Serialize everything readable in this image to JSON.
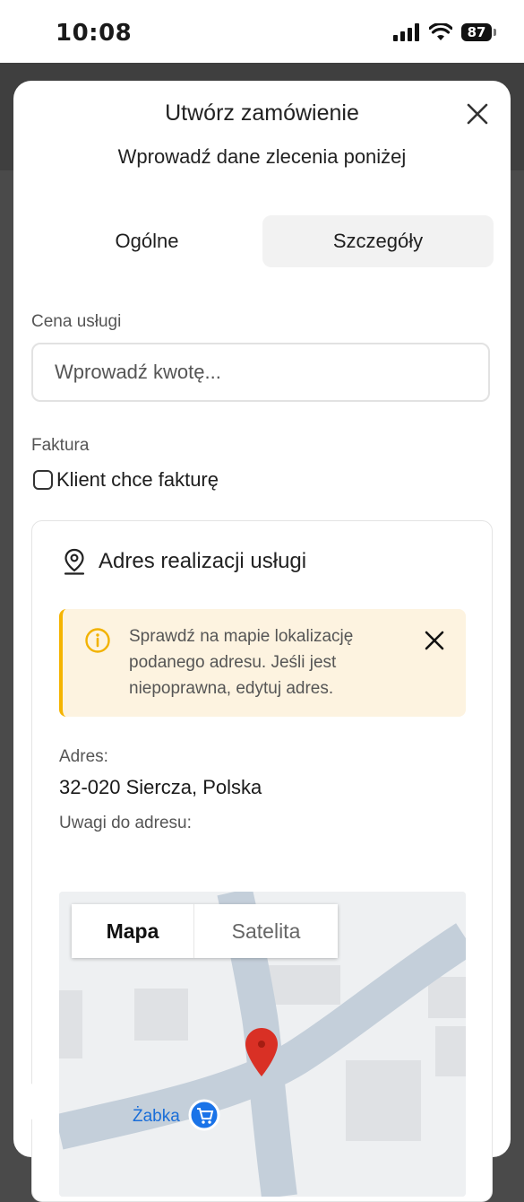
{
  "status_bar": {
    "time": "10:08",
    "battery": "87"
  },
  "dialog": {
    "title": "Utwórz zamówienie",
    "subtitle": "Wprowadź dane zlecenia poniżej",
    "tabs": [
      {
        "label": "Ogólne",
        "active": false
      },
      {
        "label": "Szczegóły",
        "active": true
      }
    ],
    "price": {
      "label": "Cena usługi",
      "placeholder": "Wprowadź kwotę...",
      "value": ""
    },
    "invoice": {
      "label": "Faktura",
      "checkbox_label": "Klient chce fakturę",
      "checked": false
    },
    "address_section": {
      "title": "Adres realizacji usługi",
      "alert_text": "Sprawdź na mapie lokalizację podanego adresu. Jeśli jest niepoprawna, edytuj adres.",
      "address_label": "Adres:",
      "address_value": "32-020 Siercza, Polska",
      "notes_label": "Uwagi do adresu:",
      "notes_value": ""
    },
    "map": {
      "view_options": [
        "Mapa",
        "Satelita"
      ],
      "selected_view": "Mapa",
      "poi_label": "Żabka"
    }
  },
  "colors": {
    "alert_bg": "#fdf3e0",
    "alert_accent": "#f5b400",
    "map_pin": "#d93025",
    "poi_blue": "#1a73e8"
  }
}
